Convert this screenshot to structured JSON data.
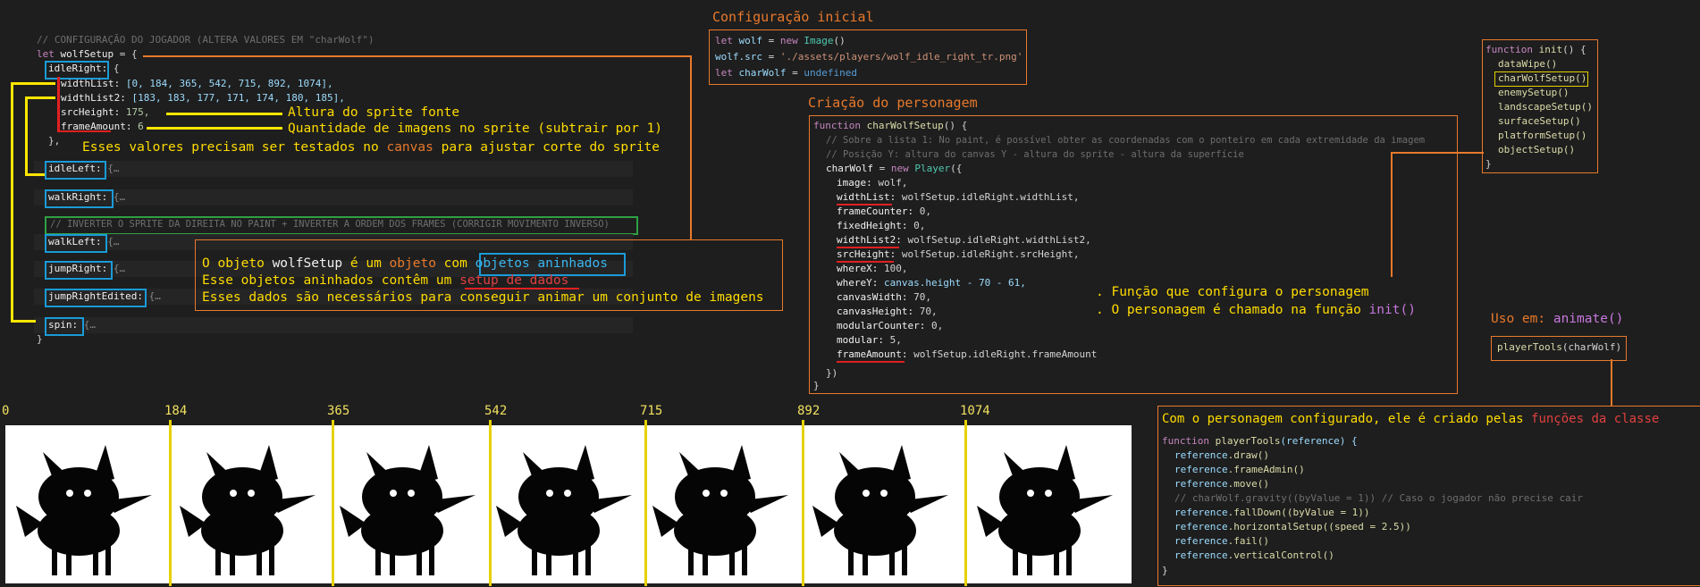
{
  "left_code": {
    "comment": "// CONFIGURAÇÃO DO JOGADOR (ALTERA VALORES EM \"charWolf\")",
    "let_kw": "let",
    "var_name": "wolfSetup",
    "assign": " = {",
    "idleRight_key": "idleRight:",
    "open_brace": " {",
    "widthList_key": "widthList:",
    "widthList_val": " [0, 184, 365, 542, 715, 892, 1074],",
    "widthList2_key": "widthList2:",
    "widthList2_val": " [183, 183, 177, 171, 174, 180, 185],",
    "srcHeight_key": "srcHeight:",
    "srcHeight_val": " 175,",
    "frameAmount_key": "frameAmount:",
    "frameAmount_val": " 6",
    "close_inner": "},",
    "idleLeft_key": "idleLeft:",
    "walkRight_key": "walkRight:",
    "green_comment": "// INVERTER O SPRITE DA DIREITA NO PAINT + INVERTER A ORDEM DOS FRAMES (CORRIGIR MOVIMENTO INVERSO)",
    "walkLeft_key": "walkLeft:",
    "jumpRight_key": "jumpRight:",
    "jumpRightEdited_key": "jumpRightEdited:",
    "spin_key": "spin:",
    "folded": " {…",
    "close_outer": "}"
  },
  "annotations": {
    "srcHeight_note": "Altura do sprite fonte",
    "frameAmount_note": "Quantidade de imagens no sprite (subtrair por 1)",
    "values_note_a": "Esses valores precisam ser testados no ",
    "values_note_canvas": "canvas",
    "values_note_b": " para ajustar corte do sprite"
  },
  "object_box": {
    "line1_a": "O objeto ",
    "line1_b": "wolfSetup",
    "line1_c": " é um ",
    "line1_d": "objeto",
    "line1_e": " com ",
    "line1_f": "objetos aninhados",
    "line2_a": "Esse objetos aninhados contêm um ",
    "line2_b": "setup de dados",
    "line3": "Esses dados são necessários para conseguir animar um conjunto de imagens"
  },
  "initial_config": {
    "title": "Configuração inicial",
    "l1_kw": "let",
    "l1_var": " wolf",
    "l1_op": " = ",
    "l1_new": "new",
    "l1_cls": " Image",
    "l1_end": "()",
    "l2_obj": "wolf",
    "l2_prop": ".src",
    "l2_op": " = ",
    "l2_str": "'./assets/players/wolf_idle_right_tr.png'",
    "l3_kw": "let",
    "l3_var": " charWolf",
    "l3_op": " = ",
    "l3_val": "undefined"
  },
  "character_creation": {
    "title": "Criação do personagem",
    "fn_kw": "function",
    "fn_name": " charWolfSetup",
    "fn_open": "() {",
    "c1": "// Sobre a lista 1: No paint, é possível obter as coordenadas com o ponteiro em cada extremidade da imagem",
    "c2": "// Posição Y: altura do canvas Y - altura do sprite - altura da superfície",
    "assign_var": "charWolf",
    "assign_op": " = ",
    "assign_new": "new",
    "assign_cls": " Player",
    "assign_open": "({",
    "props": [
      {
        "key": "image:",
        "val": " wolf,"
      },
      {
        "key": "widthList:",
        "val": " wolfSetup.idleRight.widthList,"
      },
      {
        "key": "frameCounter:",
        "val": " 0,"
      },
      {
        "key": "fixedHeight:",
        "val": " 0,"
      },
      {
        "key": "widthList2:",
        "val": " wolfSetup.idleRight.widthList2,"
      },
      {
        "key": "srcHeight:",
        "val": " wolfSetup.idleRight.srcHeight,"
      },
      {
        "key": "whereX:",
        "val": " 100,"
      },
      {
        "key": "whereY:",
        "val": " canvas.height - 70 - 61,"
      },
      {
        "key": "canvasWidth:",
        "val": " 70,"
      },
      {
        "key": "canvasHeight:",
        "val": " 70,"
      },
      {
        "key": "modularCounter:",
        "val": " 0,"
      },
      {
        "key": "modular:",
        "val": " 5,"
      },
      {
        "key": "frameAmount:",
        "val": " wolfSetup.idleRight.frameAmount"
      }
    ],
    "close_call": "})",
    "close_fn": "}",
    "note1": ". Função que configura o personagem",
    "note2_a": ". O personagem é chamado na função ",
    "note2_b": "init()"
  },
  "init_box": {
    "fn_kw": "function",
    "fn_name": " init",
    "fn_open": "() {",
    "calls": [
      "dataWipe()",
      "charWolfSetup()",
      "enemySetup()",
      "landscapeSetup()",
      "surfaceSetup()",
      "platformSetup()",
      "objectSetup()"
    ],
    "close": "}"
  },
  "usage": {
    "label_a": "Uso em: ",
    "label_b": "animate()",
    "call_fn": "playerTools",
    "call_arg": "(charWolf)"
  },
  "class_box": {
    "title_a": "Com o personagem configurado, ele é criado pelas ",
    "title_b": "funções da classe",
    "fn_kw": "function",
    "fn_name": " playerTools",
    "fn_param": "(reference) {",
    "lines": [
      {
        "obj": "reference",
        "rest": ".draw()"
      },
      {
        "obj": "reference",
        "rest": ".frameAdmin()"
      },
      {
        "obj": "reference",
        "rest": ".move()"
      },
      {
        "comment": "// charWolf.gravity((byValue = 1)) // Caso o jogador não precise cair"
      },
      {
        "obj": "reference",
        "rest": ".fallDown((byValue = 1))"
      },
      {
        "obj": "reference",
        "rest": ".horizontalSetup((speed = 2.5))"
      },
      {
        "obj": "reference",
        "rest": ".fail()"
      },
      {
        "obj": "reference",
        "rest": ".verticalControl()"
      }
    ],
    "close": "}"
  },
  "sprite_strip": {
    "ticks": [
      "0",
      "184",
      "365",
      "542",
      "715",
      "892",
      "1074"
    ],
    "frame_count": 7
  },
  "colors": {
    "background": "#1e1e1e",
    "accent_orange": "#e8792b",
    "highlight_blue": "#1a9bd7",
    "marker_yellow": "#ffe600",
    "marker_red": "#e02020",
    "marker_green": "#2ea043"
  }
}
